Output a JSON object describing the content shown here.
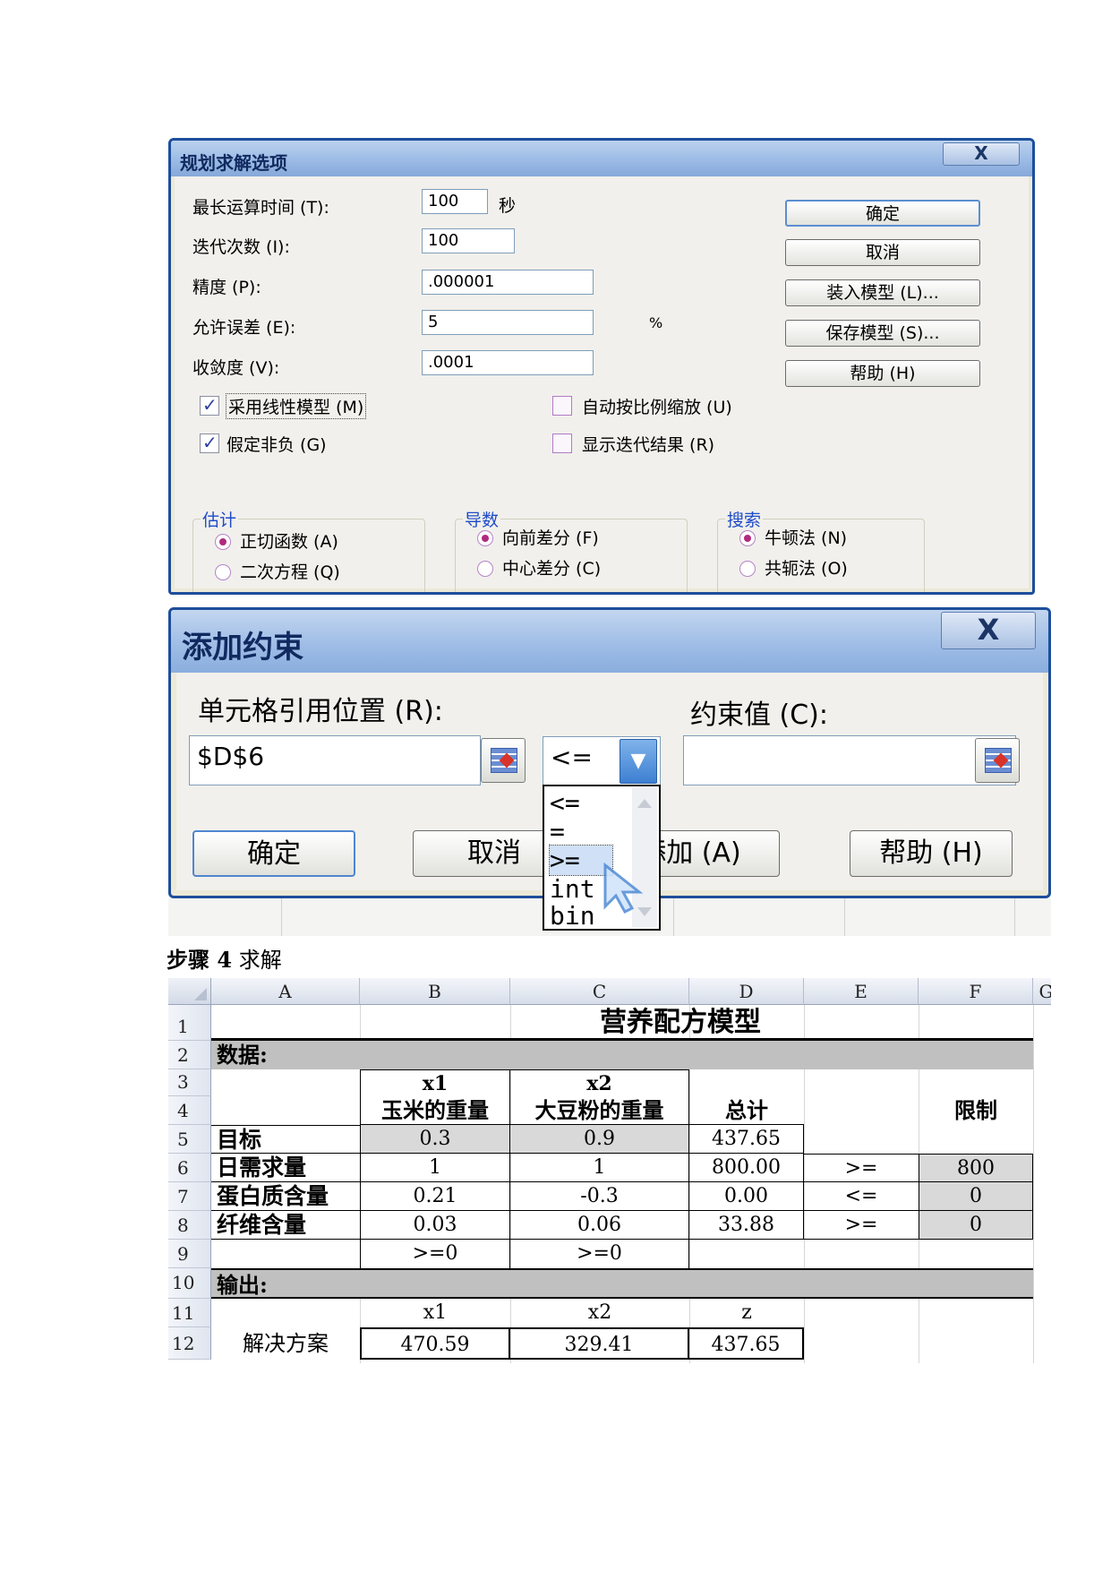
{
  "solver_options": {
    "title": "规划求解选项",
    "close_label": "X",
    "fields": [
      {
        "label": "最长运算时间 (T):",
        "value": "100",
        "unit": "秒"
      },
      {
        "label": "迭代次数 (I):",
        "value": "100",
        "unit": ""
      },
      {
        "label": "精度 (P):",
        "value": ".000001",
        "unit": ""
      },
      {
        "label": "允许误差 (E):",
        "value": "5",
        "unit": "%"
      },
      {
        "label": "收敛度 (V):",
        "value": ".0001",
        "unit": ""
      }
    ],
    "buttons": [
      "确定",
      "取消",
      "装入模型 (L)...",
      "保存模型 (S)...",
      "帮助 (H)"
    ],
    "checkboxes": [
      {
        "label": "采用线性模型 (M)",
        "checked": true
      },
      {
        "label": "自动按比例缩放 (U)",
        "checked": false
      },
      {
        "label": "假定非负 (G)",
        "checked": true
      },
      {
        "label": "显示迭代结果 (R)",
        "checked": false
      }
    ],
    "groups": [
      {
        "title": "估计",
        "options": [
          "正切函数 (A)",
          "二次方程 (Q)"
        ],
        "selected": 0
      },
      {
        "title": "导数",
        "options": [
          "向前差分 (F)",
          "中心差分 (C)"
        ],
        "selected": 0
      },
      {
        "title": "搜索",
        "options": [
          "牛顿法 (N)",
          "共轭法 (O)"
        ],
        "selected": 0
      }
    ]
  },
  "add_constraint": {
    "title": "添加约束",
    "close_label": "X",
    "cell_ref_label": "单元格引用位置 (R):",
    "cell_ref_value": "$D$6",
    "constraint_label": "约束值 (C):",
    "constraint_value": "",
    "operator_value": "<=",
    "operator_options": [
      "<=",
      "=",
      ">=",
      "int",
      "bin"
    ],
    "operator_highlight": ">=",
    "buttons": [
      "确定",
      "取消",
      "添加 (A)",
      "帮助 (H)"
    ]
  },
  "step": {
    "prefix": "步骤 4",
    "text": "求解"
  },
  "sheet": {
    "columns": [
      "A",
      "B",
      "C",
      "D",
      "E",
      "F",
      "G"
    ],
    "rows": [
      "1",
      "2",
      "3",
      "4",
      "5",
      "6",
      "7",
      "8",
      "9",
      "10",
      "11",
      "12"
    ],
    "title": "营养配方模型",
    "data_label": "数据:",
    "output_label": "输出:",
    "r3": {
      "b": "x1",
      "c": "x2"
    },
    "r4": {
      "b": "玉米的重量",
      "c": "大豆粉的重量",
      "d": "总计",
      "f": "限制"
    },
    "r5": {
      "a": "目标",
      "b": "0.3",
      "c": "0.9",
      "d": "437.65"
    },
    "r6": {
      "a": "日需求量",
      "b": "1",
      "c": "1",
      "d": "800.00",
      "e": ">=",
      "f": "800"
    },
    "r7": {
      "a": "蛋白质含量",
      "b": "0.21",
      "c": "-0.3",
      "d": "0.00",
      "e": "<=",
      "f": "0"
    },
    "r8": {
      "a": "纤维含量",
      "b": "0.03",
      "c": "0.06",
      "d": "33.88",
      "e": ">=",
      "f": "0"
    },
    "r9": {
      "b": ">=0",
      "c": ">=0"
    },
    "r11": {
      "b": "x1",
      "c": "x2",
      "d": "z"
    },
    "r12": {
      "a": "解决方案",
      "b": "470.59",
      "c": "329.41",
      "d": "437.65"
    }
  }
}
